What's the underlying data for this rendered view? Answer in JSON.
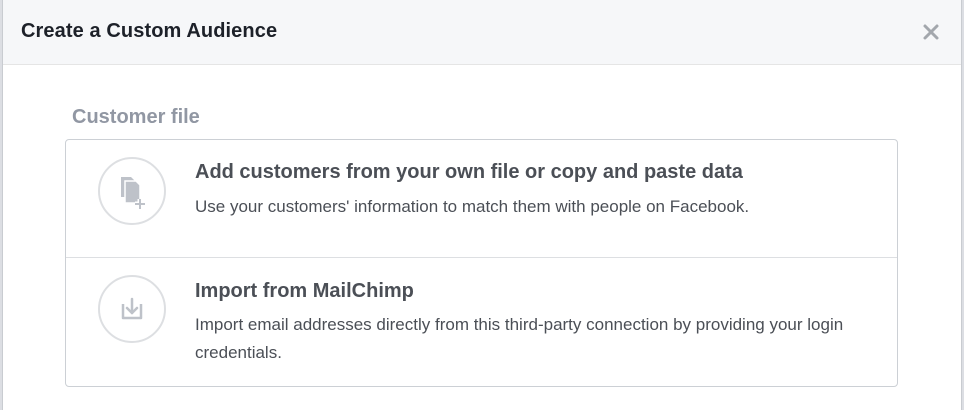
{
  "dialog": {
    "title": "Create a Custom Audience",
    "close_icon": "close-icon"
  },
  "section": {
    "title": "Customer file"
  },
  "options": [
    {
      "icon": "document-add-icon",
      "title": "Add customers from your own file or copy and paste data",
      "description": "Use your customers' information to match them with people on Facebook."
    },
    {
      "icon": "import-arrow-icon",
      "title": "Import from MailChimp",
      "description": "Import email addresses directly from this third-party connection by providing your login credentials."
    }
  ],
  "colors": {
    "header_bg": "#f6f7f9",
    "title_text": "#1d2129",
    "section_text": "#9197a3",
    "body_text": "#4b4f56",
    "icon_gray": "#bec2c9",
    "border": "#ccd0d5"
  }
}
